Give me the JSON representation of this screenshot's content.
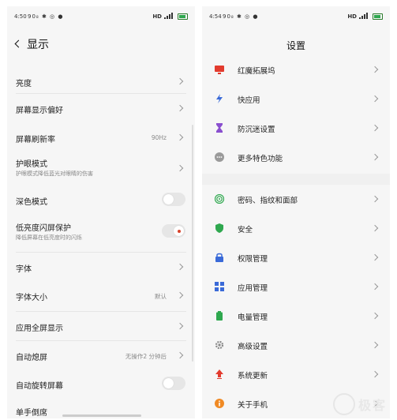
{
  "left": {
    "status": {
      "time": "4:50",
      "icons": "90₈ ✱ ◎ ●",
      "hd": "HD"
    },
    "header": {
      "title": "显示"
    },
    "items": [
      {
        "title": "亮度"
      },
      {
        "title": "屏幕显示偏好"
      },
      {
        "title": "屏幕刷新率",
        "value": "90Hz"
      },
      {
        "title": "护眼模式",
        "subtitle": "护眼模式降低蓝光对眼睛的伤害"
      },
      {
        "title": "深色模式",
        "toggle": "off"
      },
      {
        "title": "低亮度闪屏保护",
        "subtitle": "降低屏幕在低亮度时的闪烁",
        "toggle": "on"
      },
      {
        "title": "字体"
      },
      {
        "title": "字体大小",
        "value": "默认"
      },
      {
        "title": "应用全屏显示"
      },
      {
        "title": "自动熄屏",
        "value": "无操作2 分钟后"
      },
      {
        "title": "自动旋转屏幕",
        "toggle": "off"
      },
      {
        "title": "单手倒席"
      }
    ]
  },
  "right": {
    "status": {
      "time": "4:54",
      "icons": "90₈ ✱ ◎ ●",
      "hd": "HD"
    },
    "header": {
      "title": "设置"
    },
    "items": [
      {
        "title": "红魔拓展坞",
        "icon": "monitor-icon",
        "color": "#e23b2e"
      },
      {
        "title": "快应用",
        "icon": "lightning-icon",
        "color": "#3a6ad8"
      },
      {
        "title": "防沉迷设置",
        "icon": "hourglass-icon",
        "color": "#8a4fcf"
      },
      {
        "title": "更多特色功能",
        "icon": "more-icon",
        "color": "#9a9a9a"
      },
      {
        "title": "密码、指纹和面部",
        "icon": "fingerprint-icon",
        "color": "#2fa84f"
      },
      {
        "title": "安全",
        "icon": "shield-icon",
        "color": "#2fa84f"
      },
      {
        "title": "权限管理",
        "icon": "lock-icon",
        "color": "#3a6ad8"
      },
      {
        "title": "应用管理",
        "icon": "grid-icon",
        "color": "#3a6ad8"
      },
      {
        "title": "电量管理",
        "icon": "battery-icon",
        "color": "#2fa84f"
      },
      {
        "title": "高级设置",
        "icon": "gear-icon",
        "color": "#888888"
      },
      {
        "title": "系统更新",
        "icon": "update-icon",
        "color": "#e23b2e"
      },
      {
        "title": "关于手机",
        "icon": "info-icon",
        "color": "#f08a24"
      }
    ]
  },
  "watermark": "极客"
}
